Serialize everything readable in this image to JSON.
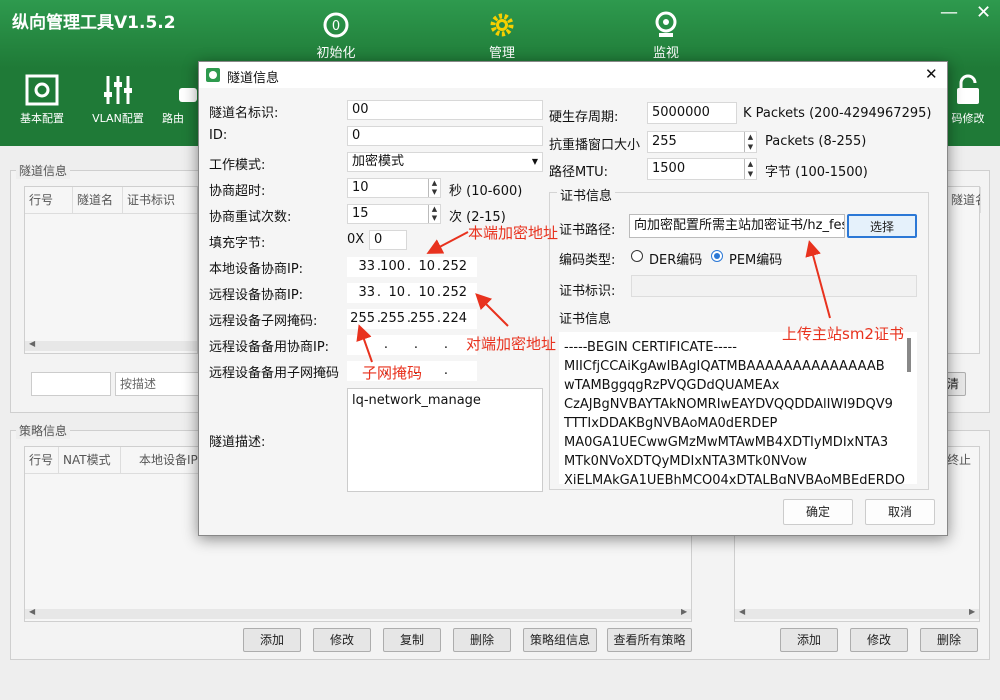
{
  "app": {
    "title": "纵向管理工具V1.5.2"
  },
  "main_nav": [
    {
      "label": "初始化",
      "icon": "init-icon"
    },
    {
      "label": "管理",
      "icon": "gear-icon"
    },
    {
      "label": "监视",
      "icon": "webcam-icon"
    }
  ],
  "toolbar": {
    "items": [
      {
        "label": "基本配置",
        "icon": "panel-icon"
      },
      {
        "label": "VLAN配置",
        "icon": "sliders-icon"
      },
      {
        "label": "路由",
        "icon": "router-icon"
      },
      {
        "label": "码修改",
        "icon": "lock-icon"
      }
    ]
  },
  "tunnel_panel": {
    "title": "隧道信息",
    "columns": [
      "行号",
      "隧道名",
      "证书标识"
    ],
    "right_col": "隧道名",
    "search_placeholder": "按描述",
    "clear": "清"
  },
  "policy_panel": {
    "title": "策略信息",
    "columns": [
      "行号",
      "NAT模式",
      "本地设备IP"
    ],
    "right_col": "终止",
    "buttons": [
      "添加",
      "修改",
      "复制",
      "删除",
      "策略组信息",
      "查看所有策略"
    ],
    "right_buttons": [
      "添加",
      "修改",
      "删除"
    ]
  },
  "dialog": {
    "title": "隧道信息",
    "left": {
      "name_label": "隧道名标识:",
      "name_value": "00",
      "id_label": "ID:",
      "id_value": "0",
      "mode_label": "工作模式:",
      "mode_value": "加密模式",
      "timeout_label": "协商超时:",
      "timeout_value": "10",
      "timeout_unit": "秒 (10-600)",
      "retry_label": "协商重试次数:",
      "retry_value": "15",
      "retry_unit": "次 (2-15)",
      "pad_label": "填充字节:",
      "pad_prefix": "0X",
      "pad_value": "0",
      "local_ip_label": "本地设备协商IP:",
      "local_ip": [
        "33",
        "100",
        "10",
        "252"
      ],
      "remote_ip_label": "远程设备协商IP:",
      "remote_ip": [
        "33",
        "10",
        "10",
        "252"
      ],
      "remote_mask_label": "远程设备子网掩码:",
      "remote_mask": [
        "255",
        "255",
        "255",
        "224"
      ],
      "backup_ip_label": "远程设备备用协商IP:",
      "backup_mask_label": "远程设备备用子网掩码",
      "desc_label": "隧道描述:",
      "desc_value": "lq-network_manage"
    },
    "right": {
      "hw_cycle_label": "硬生存周期:",
      "hw_cycle_value": "5000000",
      "hw_cycle_unit": "K Packets (200-4294967295)",
      "replay_label": "抗重播窗口大小",
      "replay_value": "255",
      "replay_unit": "Packets (8-255)",
      "mtu_label": "路径MTU:",
      "mtu_value": "1500",
      "mtu_unit": "字节 (100-1500)",
      "cert_group": "证书信息",
      "cert_path_label": "证书路径:",
      "cert_path_value": "向加密配置所需主站加密证书/hz_fes",
      "select_button": "选择",
      "encoding_label": "编码类型:",
      "der_label": "DER编码",
      "pem_label": "PEM编码",
      "cert_id_label": "证书标识:",
      "cert_info_label": "证书信息",
      "cert_lines": [
        "-----BEGIN CERTIFICATE-----",
        "MIICfjCCAiKgAwIBAgIQATMBAAAAAAAAAAAAAAB",
        "wTAMBggqgRzPVQGDdQUAMEAx",
        "CzAJBgNVBAYTAkNOMRIwEAYDVQQDDAlIWI9DQV9",
        "TTTIxDDAKBgNVBAoMA0dERDEP",
        "MA0GA1UECwwGMzMwMTAwMB4XDTIyMDIxNTA3",
        "MTk0NVoXDTQyMDIxNTA3MTk0NVow",
        "XjELMAkGA1UEBhMCQ04xDTALBgNVBAoMBEdERDO"
      ]
    },
    "ok": "确定",
    "cancel": "取消"
  },
  "annotations": {
    "local": "本端加密地址",
    "remote": "对端加密地址",
    "mask": "子网掩码",
    "cert": "上传主站sm2证书"
  },
  "colors": {
    "header": "#2e9a4e",
    "header_dark": "#1f7a37",
    "annotation": "#e8321e",
    "focus": "#2b78d6"
  }
}
